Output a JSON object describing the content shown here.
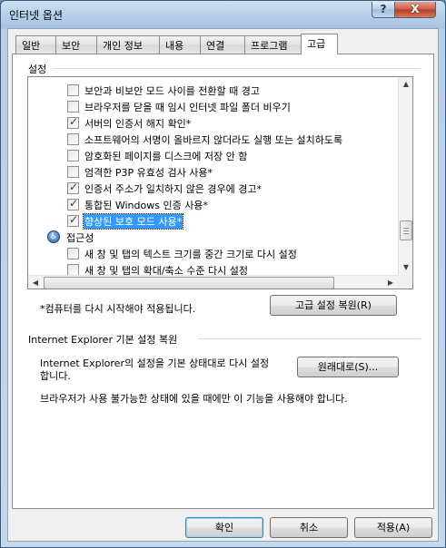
{
  "window": {
    "title": "인터넷 옵션",
    "help_glyph": "?",
    "close_glyph": "X"
  },
  "tabs": [
    {
      "label": "일반"
    },
    {
      "label": "보안"
    },
    {
      "label": "개인 정보"
    },
    {
      "label": "내용"
    },
    {
      "label": "연결"
    },
    {
      "label": "프로그램"
    },
    {
      "label": "고급",
      "active": true
    }
  ],
  "settings": {
    "group_title": "설정",
    "items": [
      {
        "type": "checkbox",
        "checked": false,
        "label": "보안과 비보안 모드 사이를 전환할 때 경고"
      },
      {
        "type": "checkbox",
        "checked": false,
        "label": "브라우저를 닫을 때 임시 인터넷 파일 폴더 비우기"
      },
      {
        "type": "checkbox",
        "checked": true,
        "label": "서버의 인증서 해지 확인*"
      },
      {
        "type": "checkbox",
        "checked": false,
        "label": "소프트웨어의 서명이 올바르지 않더라도 실행 또는 설치하도록"
      },
      {
        "type": "checkbox",
        "checked": false,
        "label": "암호화된 페이지를 디스크에 저장 안 함"
      },
      {
        "type": "checkbox",
        "checked": false,
        "label": "엄격한 P3P 유효성 검사 사용*"
      },
      {
        "type": "checkbox",
        "checked": true,
        "label": "인증서 주소가 일치하지 않은 경우에 경고*"
      },
      {
        "type": "checkbox",
        "checked": true,
        "label": "통합된 Windows 인증 사용*"
      },
      {
        "type": "checkbox",
        "checked": true,
        "label": "향상된 보호 모드 사용*",
        "selected": true
      },
      {
        "type": "category",
        "label": "접근성"
      },
      {
        "type": "checkbox",
        "checked": false,
        "label": "새 창 및 탭의 텍스트 크기를 중간 크기로 다시 설정"
      },
      {
        "type": "checkbox",
        "checked": false,
        "label": "새 창 및 탭의 확대/축소 수준 다시 설정"
      }
    ],
    "footnote": "*컴퓨터를 다시 시작해야 적용됩니다.",
    "restore_advanced_button": "고급 설정 복원(R)"
  },
  "reset": {
    "group_title": "Internet Explorer 기본 설정 복원",
    "description_line1": "Internet Explorer의 설정을 기본 상태대로 다시 설정",
    "description_line2": "합니다.",
    "reset_button": "원래대로(S)...",
    "warning": "브라우저가 사용 불가능한 상태에 있을 때에만 이 기능을 사용해야 합니다."
  },
  "footer": {
    "ok_button": "확인",
    "cancel_button": "취소",
    "apply_button": "적용(A)"
  },
  "icons": {
    "category": "accessibility-icon",
    "check": "checkmark-icon"
  }
}
